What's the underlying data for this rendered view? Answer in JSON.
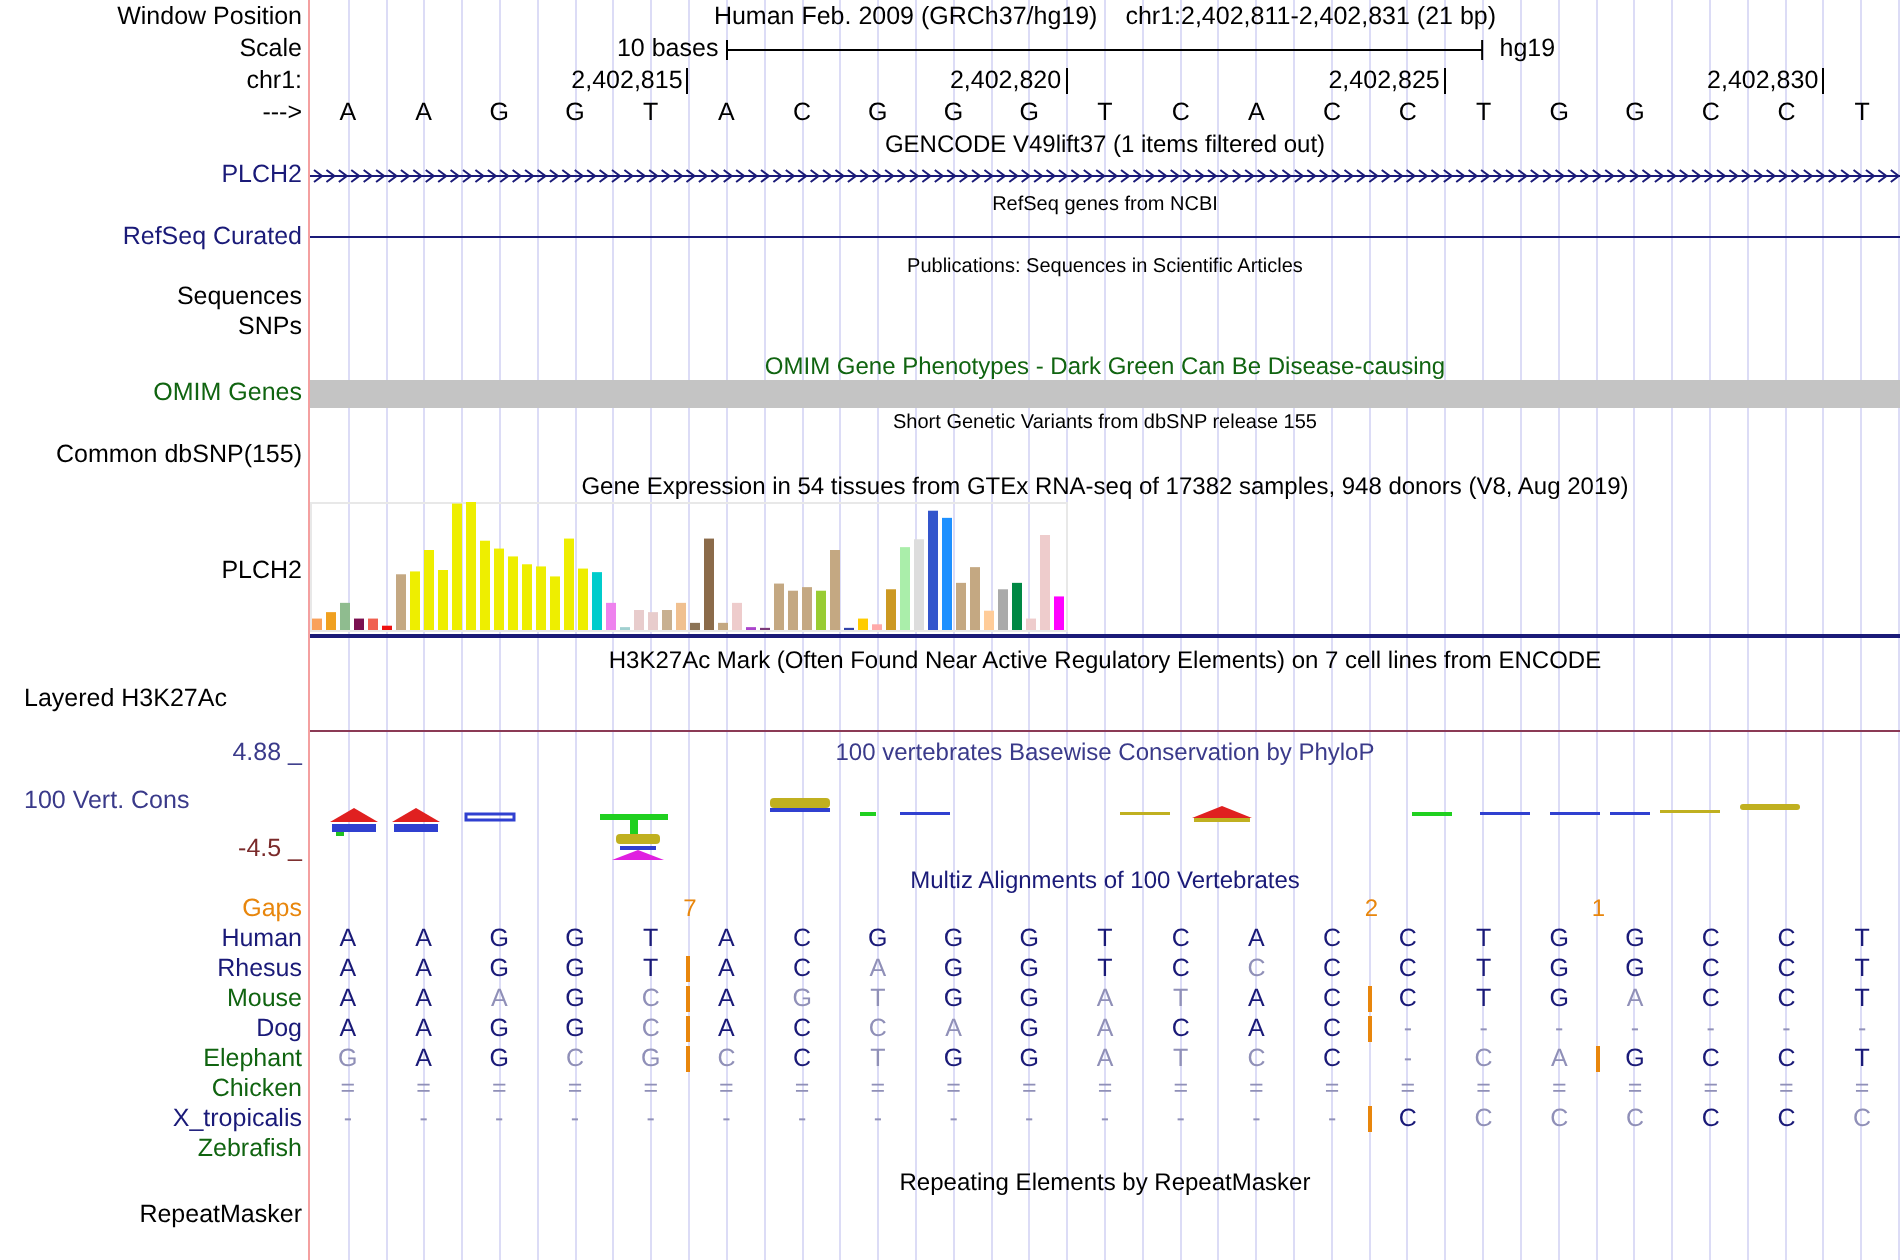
{
  "header": {
    "window_position_label": "Window Position",
    "assembly": "Human Feb. 2009 (GRCh37/hg19)",
    "position": "chr1:2,402,811-2,402,831 (21 bp)",
    "scale_label": "Scale",
    "scale_text": "10 bases",
    "scale_assembly": "hg19",
    "chrom_label": "chr1:",
    "ticks": [
      "2,402,815",
      "2,402,820",
      "2,402,825",
      "2,402,830"
    ],
    "strand_label": "--->",
    "bases": [
      "A",
      "A",
      "G",
      "G",
      "T",
      "A",
      "C",
      "G",
      "G",
      "G",
      "T",
      "C",
      "A",
      "C",
      "C",
      "T",
      "G",
      "G",
      "C",
      "C",
      "T"
    ]
  },
  "gencode": {
    "title": "GENCODE V49lift37 (1 items filtered out)",
    "label": "PLCH2"
  },
  "refseq": {
    "title": "RefSeq genes from NCBI",
    "label": "RefSeq Curated"
  },
  "publications": {
    "title": "Publications: Sequences in Scientific Articles",
    "labels": [
      "Sequences",
      "SNPs"
    ]
  },
  "omim": {
    "title": "OMIM Gene Phenotypes - Dark Green Can Be Disease-causing",
    "label": "OMIM Genes"
  },
  "dbsnp": {
    "title": "Short Genetic Variants from dbSNP release 155",
    "label": "Common dbSNP(155)"
  },
  "gtex": {
    "title": "Gene Expression in 54 tissues from GTEx RNA-seq of 17382 samples, 948 donors (V8, Aug 2019)",
    "label": "PLCH2"
  },
  "h3k27ac": {
    "title": "H3K27Ac Mark (Often Found Near Active Regulatory Elements) on 7 cell lines from ENCODE",
    "label": "Layered H3K27Ac"
  },
  "conservation": {
    "title": "100 vertebrates Basewise Conservation by PhyloP",
    "label": "100 Vert. Cons",
    "max": "4.88 _",
    "min": "-4.5 _"
  },
  "multiz": {
    "title": "Multiz Alignments of 100 Vertebrates",
    "gaps_label": "Gaps",
    "gaps": [
      {
        "count": "7"
      },
      {
        "count": "2"
      },
      {
        "count": "1"
      }
    ],
    "species": [
      {
        "name": "Human",
        "color": "#1a1a78",
        "cells": [
          {
            "b": "A",
            "match": true
          },
          {
            "b": "A",
            "match": true
          },
          {
            "b": "G",
            "match": true
          },
          {
            "b": "G",
            "match": true
          },
          {
            "b": "T",
            "match": true
          },
          {
            "b": "A",
            "match": true
          },
          {
            "b": "C",
            "match": true
          },
          {
            "b": "G",
            "match": true
          },
          {
            "b": "G",
            "match": true
          },
          {
            "b": "G",
            "match": true
          },
          {
            "b": "T",
            "match": true
          },
          {
            "b": "C",
            "match": true
          },
          {
            "b": "A",
            "match": true
          },
          {
            "b": "C",
            "match": true
          },
          {
            "b": "C",
            "match": true
          },
          {
            "b": "T",
            "match": true
          },
          {
            "b": "G",
            "match": true
          },
          {
            "b": "G",
            "match": true
          },
          {
            "b": "C",
            "match": true
          },
          {
            "b": "C",
            "match": true
          },
          {
            "b": "T",
            "match": true
          }
        ]
      },
      {
        "name": "Rhesus",
        "color": "#1a1a78",
        "cells": [
          {
            "b": "A",
            "match": true
          },
          {
            "b": "A",
            "match": true
          },
          {
            "b": "G",
            "match": true
          },
          {
            "b": "G",
            "match": true
          },
          {
            "b": "T",
            "match": true,
            "insert": true
          },
          {
            "b": "A",
            "match": true
          },
          {
            "b": "C",
            "match": true
          },
          {
            "b": "A",
            "match": false
          },
          {
            "b": "G",
            "match": true
          },
          {
            "b": "G",
            "match": true
          },
          {
            "b": "T",
            "match": true
          },
          {
            "b": "C",
            "match": true
          },
          {
            "b": "C",
            "match": false
          },
          {
            "b": "C",
            "match": true
          },
          {
            "b": "C",
            "match": true
          },
          {
            "b": "T",
            "match": true
          },
          {
            "b": "G",
            "match": true
          },
          {
            "b": "G",
            "match": true
          },
          {
            "b": "C",
            "match": true
          },
          {
            "b": "C",
            "match": true
          },
          {
            "b": "T",
            "match": true
          }
        ]
      },
      {
        "name": "Mouse",
        "color": "#106410",
        "cells": [
          {
            "b": "A",
            "match": true
          },
          {
            "b": "A",
            "match": true
          },
          {
            "b": "A",
            "match": false
          },
          {
            "b": "G",
            "match": true
          },
          {
            "b": "C",
            "match": false,
            "insert": true
          },
          {
            "b": "A",
            "match": true
          },
          {
            "b": "G",
            "match": false
          },
          {
            "b": "T",
            "match": false
          },
          {
            "b": "G",
            "match": true
          },
          {
            "b": "G",
            "match": true
          },
          {
            "b": "A",
            "match": false
          },
          {
            "b": "T",
            "match": false
          },
          {
            "b": "A",
            "match": true
          },
          {
            "b": "C",
            "match": true,
            "insert": true
          },
          {
            "b": "C",
            "match": true
          },
          {
            "b": "T",
            "match": true
          },
          {
            "b": "G",
            "match": true
          },
          {
            "b": "A",
            "match": false
          },
          {
            "b": "C",
            "match": true
          },
          {
            "b": "C",
            "match": true
          },
          {
            "b": "T",
            "match": true
          }
        ]
      },
      {
        "name": "Dog",
        "color": "#1a1a78",
        "cells": [
          {
            "b": "A",
            "match": true
          },
          {
            "b": "A",
            "match": true
          },
          {
            "b": "G",
            "match": true
          },
          {
            "b": "G",
            "match": true
          },
          {
            "b": "C",
            "match": false,
            "insert": true
          },
          {
            "b": "A",
            "match": true
          },
          {
            "b": "C",
            "match": true
          },
          {
            "b": "C",
            "match": false
          },
          {
            "b": "A",
            "match": false
          },
          {
            "b": "G",
            "match": true
          },
          {
            "b": "A",
            "match": false
          },
          {
            "b": "C",
            "match": true
          },
          {
            "b": "A",
            "match": true
          },
          {
            "b": "C",
            "match": true,
            "insert": true
          },
          {
            "b": "-",
            "match": false
          },
          {
            "b": "-",
            "match": false
          },
          {
            "b": "-",
            "match": false
          },
          {
            "b": "-",
            "match": false
          },
          {
            "b": "-",
            "match": false
          },
          {
            "b": "-",
            "match": false
          },
          {
            "b": "-",
            "match": false
          }
        ]
      },
      {
        "name": "Elephant",
        "color": "#106410",
        "cells": [
          {
            "b": "G",
            "match": false
          },
          {
            "b": "A",
            "match": true
          },
          {
            "b": "G",
            "match": true
          },
          {
            "b": "C",
            "match": false
          },
          {
            "b": "G",
            "match": false,
            "insert": true
          },
          {
            "b": "C",
            "match": false
          },
          {
            "b": "C",
            "match": true
          },
          {
            "b": "T",
            "match": false
          },
          {
            "b": "G",
            "match": true
          },
          {
            "b": "G",
            "match": true
          },
          {
            "b": "A",
            "match": false
          },
          {
            "b": "T",
            "match": false
          },
          {
            "b": "C",
            "match": false
          },
          {
            "b": "C",
            "match": true
          },
          {
            "b": "-",
            "match": false
          },
          {
            "b": "C",
            "match": false
          },
          {
            "b": "A",
            "match": false,
            "insert": true
          },
          {
            "b": "G",
            "match": true
          },
          {
            "b": "C",
            "match": true
          },
          {
            "b": "C",
            "match": true
          },
          {
            "b": "T",
            "match": true
          }
        ]
      },
      {
        "name": "Chicken",
        "color": "#106410",
        "cells": [
          {
            "b": "=",
            "match": false
          },
          {
            "b": "=",
            "match": false
          },
          {
            "b": "=",
            "match": false
          },
          {
            "b": "=",
            "match": false
          },
          {
            "b": "=",
            "match": false
          },
          {
            "b": "=",
            "match": false
          },
          {
            "b": "=",
            "match": false
          },
          {
            "b": "=",
            "match": false
          },
          {
            "b": "=",
            "match": false
          },
          {
            "b": "=",
            "match": false
          },
          {
            "b": "=",
            "match": false
          },
          {
            "b": "=",
            "match": false
          },
          {
            "b": "=",
            "match": false
          },
          {
            "b": "=",
            "match": false
          },
          {
            "b": "=",
            "match": false
          },
          {
            "b": "=",
            "match": false
          },
          {
            "b": "=",
            "match": false
          },
          {
            "b": "=",
            "match": false
          },
          {
            "b": "=",
            "match": false
          },
          {
            "b": "=",
            "match": false
          },
          {
            "b": "=",
            "match": false
          }
        ]
      },
      {
        "name": "X_tropicalis",
        "color": "#1a1a78",
        "cells": [
          {
            "b": "-",
            "match": false
          },
          {
            "b": "-",
            "match": false
          },
          {
            "b": "-",
            "match": false
          },
          {
            "b": "-",
            "match": false
          },
          {
            "b": "-",
            "match": false
          },
          {
            "b": "-",
            "match": false
          },
          {
            "b": "-",
            "match": false
          },
          {
            "b": "-",
            "match": false
          },
          {
            "b": "-",
            "match": false
          },
          {
            "b": "-",
            "match": false
          },
          {
            "b": "-",
            "match": false
          },
          {
            "b": "-",
            "match": false
          },
          {
            "b": "-",
            "match": false
          },
          {
            "b": "-",
            "match": false,
            "insert": true
          },
          {
            "b": "C",
            "match": true
          },
          {
            "b": "C",
            "match": false
          },
          {
            "b": "C",
            "match": false
          },
          {
            "b": "C",
            "match": false
          },
          {
            "b": "C",
            "match": true
          },
          {
            "b": "C",
            "match": true
          },
          {
            "b": "C",
            "match": false
          }
        ]
      },
      {
        "name": "Zebrafish",
        "color": "#106410"
      }
    ]
  },
  "repeatmasker": {
    "title": "Repeating Elements by RepeatMasker",
    "label": "RepeatMasker"
  }
}
